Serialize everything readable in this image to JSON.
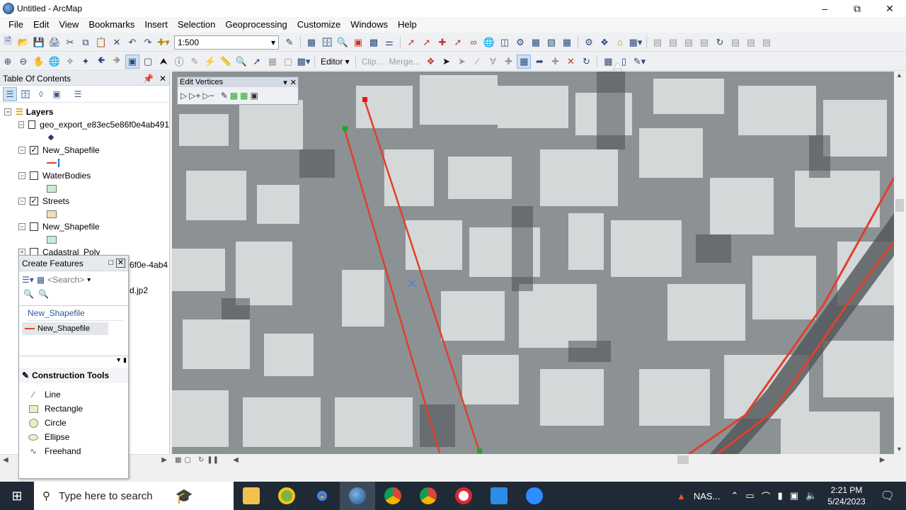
{
  "window": {
    "title": "Untitled - ArcMap",
    "minimize": "–",
    "maximize": "⧉",
    "close": "✕"
  },
  "menu": [
    "File",
    "Edit",
    "View",
    "Bookmarks",
    "Insert",
    "Selection",
    "Geoprocessing",
    "Customize",
    "Windows",
    "Help"
  ],
  "toolbar": {
    "scale_value": "1:500",
    "editor_label": "Editor ▾",
    "clip_label": "Clip...",
    "merge_label": "Merge..."
  },
  "toc": {
    "title": "Table Of Contents",
    "root_label": "Layers",
    "layers": [
      {
        "name": "geo_export_e83ec5e86f0e4ab491",
        "checked": "",
        "symbol_color": "#3a2a6a",
        "symbol_type": "point"
      },
      {
        "name": "New_Shapefile",
        "checked": "✓",
        "symbol_color": "#e0402a",
        "symbol_type": "line"
      },
      {
        "name": "WaterBodies",
        "checked": "",
        "symbol_color": "#c8ecd5",
        "symbol_type": "poly"
      },
      {
        "name": "Streets",
        "checked": "✓",
        "symbol_color": "#f3dcb4",
        "symbol_type": "poly"
      },
      {
        "name": "New_Shapefile",
        "checked": "",
        "symbol_color": "#c9ecd8",
        "symbol_type": "poly"
      },
      {
        "name": "Cadastral_Poly",
        "checked": "",
        "symbol_color": "",
        "symbol_type": "none"
      }
    ],
    "hidden_text_1": "6f0e-4ab4",
    "hidden_text_2": "d.jp2"
  },
  "create_features": {
    "title": "Create Features",
    "search_placeholder": "<Search>",
    "group_label": "New_Shapefile",
    "template_label": "New_Shapefile",
    "construction_header": "Construction Tools",
    "tools": [
      {
        "label": "Line",
        "icon": "line-tool-icon"
      },
      {
        "label": "Rectangle",
        "icon": "rectangle-tool-icon"
      },
      {
        "label": "Circle",
        "icon": "circle-tool-icon"
      },
      {
        "label": "Ellipse",
        "icon": "ellipse-tool-icon"
      },
      {
        "label": "Freehand",
        "icon": "freehand-tool-icon"
      }
    ]
  },
  "edit_vertices": {
    "title": "Edit Vertices"
  },
  "taskbar": {
    "search_placeholder": "Type here to search",
    "tray_label": "NAS...",
    "time": "2:21 PM",
    "date": "5/24/2023"
  },
  "colors": {
    "accent": "#2d4a7a",
    "edit_line": "#e0402a",
    "taskbar": "#1f2a36"
  }
}
